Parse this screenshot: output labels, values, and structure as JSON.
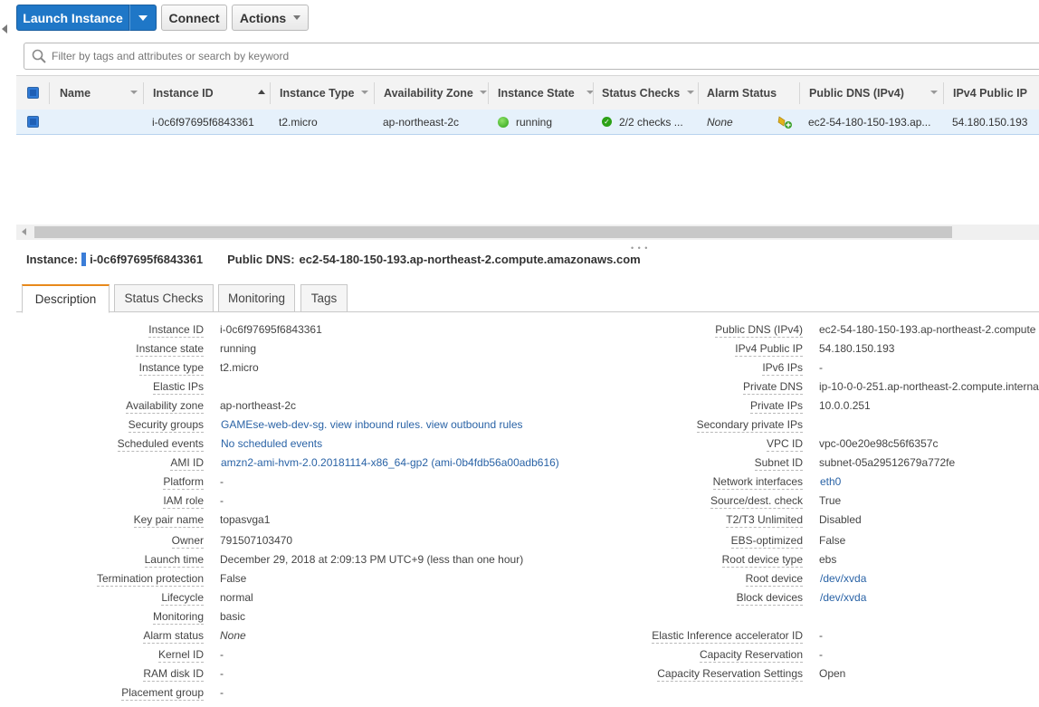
{
  "toolbar": {
    "launch_label": "Launch Instance",
    "connect_label": "Connect",
    "actions_label": "Actions"
  },
  "search": {
    "placeholder": "Filter by tags and attributes or search by keyword"
  },
  "table": {
    "columns": [
      "Name",
      "Instance ID",
      "Instance Type",
      "Availability Zone",
      "Instance State",
      "Status Checks",
      "Alarm Status",
      "Public DNS (IPv4)",
      "IPv4 Public IP"
    ],
    "row": {
      "name": "",
      "instance_id": "i-0c6f97695f6843361",
      "instance_type": "t2.micro",
      "availability_zone": "ap-northeast-2c",
      "instance_state": "running",
      "status_checks": "2/2 checks ...",
      "alarm_status": "None",
      "public_dns": "ec2-54-180-150-193.ap...",
      "ipv4_public_ip": "54.180.150.193"
    },
    "state_color": "#2ca116"
  },
  "instance_bar": {
    "instance_label": "Instance:",
    "instance_id": "i-0c6f97695f6843361",
    "dns_label": "Public DNS:",
    "dns_value": "ec2-54-180-150-193.ap-northeast-2.compute.amazonaws.com"
  },
  "tabs": [
    "Description",
    "Status Checks",
    "Monitoring",
    "Tags"
  ],
  "details_left": [
    {
      "label": "Instance ID",
      "value": "i-0c6f97695f6843361"
    },
    {
      "label": "Instance state",
      "value": "running"
    },
    {
      "label": "Instance type",
      "value": "t2.micro"
    },
    {
      "label": "Elastic IPs",
      "value": ""
    },
    {
      "label": "Availability zone",
      "value": "ap-northeast-2c"
    },
    {
      "label": "Security groups",
      "value": "GAMEse-web-dev-sg. view inbound rules. view outbound rules"
    },
    {
      "label": "Scheduled events",
      "value": "No scheduled events"
    },
    {
      "label": "AMI ID",
      "value": "amzn2-ami-hvm-2.0.20181114-x86_64-gp2 (ami-0b4fdb56a00adb616)"
    },
    {
      "label": "Platform",
      "value": "-"
    },
    {
      "label": "IAM role",
      "value": "-"
    },
    {
      "label": "Key pair name",
      "value": "topasvga1"
    },
    {
      "label": "Owner",
      "value": "791507103470"
    },
    {
      "label": "Launch time",
      "value": "December 29, 2018 at 2:09:13 PM UTC+9 (less than one hour)"
    },
    {
      "label": "Termination protection",
      "value": "False"
    },
    {
      "label": "Lifecycle",
      "value": "normal"
    },
    {
      "label": "Monitoring",
      "value": "basic"
    },
    {
      "label": "Alarm status",
      "value": "None"
    },
    {
      "label": "Kernel ID",
      "value": "-"
    },
    {
      "label": "RAM disk ID",
      "value": "-"
    },
    {
      "label": "Placement group",
      "value": "-"
    }
  ],
  "details_right": [
    {
      "label": "Public DNS (IPv4)",
      "value": "ec2-54-180-150-193.ap-northeast-2.compute"
    },
    {
      "label": "IPv4 Public IP",
      "value": "54.180.150.193"
    },
    {
      "label": "IPv6 IPs",
      "value": "-"
    },
    {
      "label": "Private DNS",
      "value": "ip-10-0-0-251.ap-northeast-2.compute.interna"
    },
    {
      "label": "Private IPs",
      "value": "10.0.0.251"
    },
    {
      "label": "Secondary private IPs",
      "value": ""
    },
    {
      "label": "VPC ID",
      "value": "vpc-00e20e98c56f6357c"
    },
    {
      "label": "Subnet ID",
      "value": "subnet-05a29512679a772fe"
    },
    {
      "label": "Network interfaces",
      "value": "eth0"
    },
    {
      "label": "Source/dest. check",
      "value": "True"
    },
    {
      "label": "T2/T3 Unlimited",
      "value": "Disabled"
    },
    {
      "label": "EBS-optimized",
      "value": "False"
    },
    {
      "label": "Root device type",
      "value": "ebs"
    },
    {
      "label": "Root device",
      "value": "/dev/xvda"
    },
    {
      "label": "Block devices",
      "value": "/dev/xvda"
    },
    {
      "label": "Elastic Inference accelerator ID",
      "value": "-"
    },
    {
      "label": "Capacity Reservation",
      "value": "-"
    },
    {
      "label": "Capacity Reservation Settings",
      "value": "Open"
    }
  ]
}
